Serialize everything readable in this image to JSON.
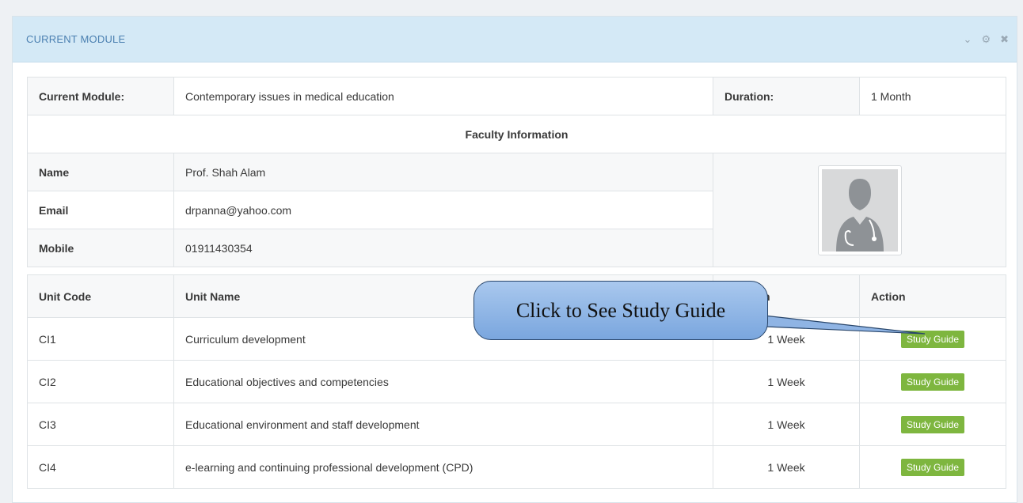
{
  "panel": {
    "title": "CURRENT MODULE",
    "tools": [
      {
        "icon": "chevron-down-icon",
        "glyph": "⌄"
      },
      {
        "icon": "gear-icon",
        "glyph": "⚙"
      },
      {
        "icon": "close-icon",
        "glyph": "✖"
      }
    ]
  },
  "module": {
    "label": "Current Module:",
    "value": "Contemporary issues in medical education",
    "duration_label": "Duration:",
    "duration_value": "1 Month"
  },
  "faculty": {
    "heading": "Faculty Information",
    "name_label": "Name",
    "name_value": "Prof. Shah Alam",
    "email_label": "Email",
    "email_value": "drpanna@yahoo.com",
    "mobile_label": "Mobile",
    "mobile_value": "01911430354"
  },
  "units": {
    "headers": [
      "Unit Code",
      "Unit Name",
      "Duration",
      "Action"
    ],
    "rows": [
      {
        "code": "CI1",
        "name": "Curriculum development",
        "duration": "1 Week",
        "action": "Study Guide"
      },
      {
        "code": "CI2",
        "name": "Educational objectives and competencies",
        "duration": "1 Week",
        "action": "Study Guide"
      },
      {
        "code": "CI3",
        "name": "Educational environment and staff development",
        "duration": "1 Week",
        "action": "Study Guide"
      },
      {
        "code": "CI4",
        "name": "e-learning and continuing professional development (CPD)",
        "duration": "1 Week",
        "action": "Study Guide"
      }
    ]
  },
  "callout": {
    "text": "Click to See Study Guide"
  },
  "colors": {
    "header_bg": "#d4e9f6",
    "title": "#4b80b1",
    "button": "#7eb63f"
  }
}
